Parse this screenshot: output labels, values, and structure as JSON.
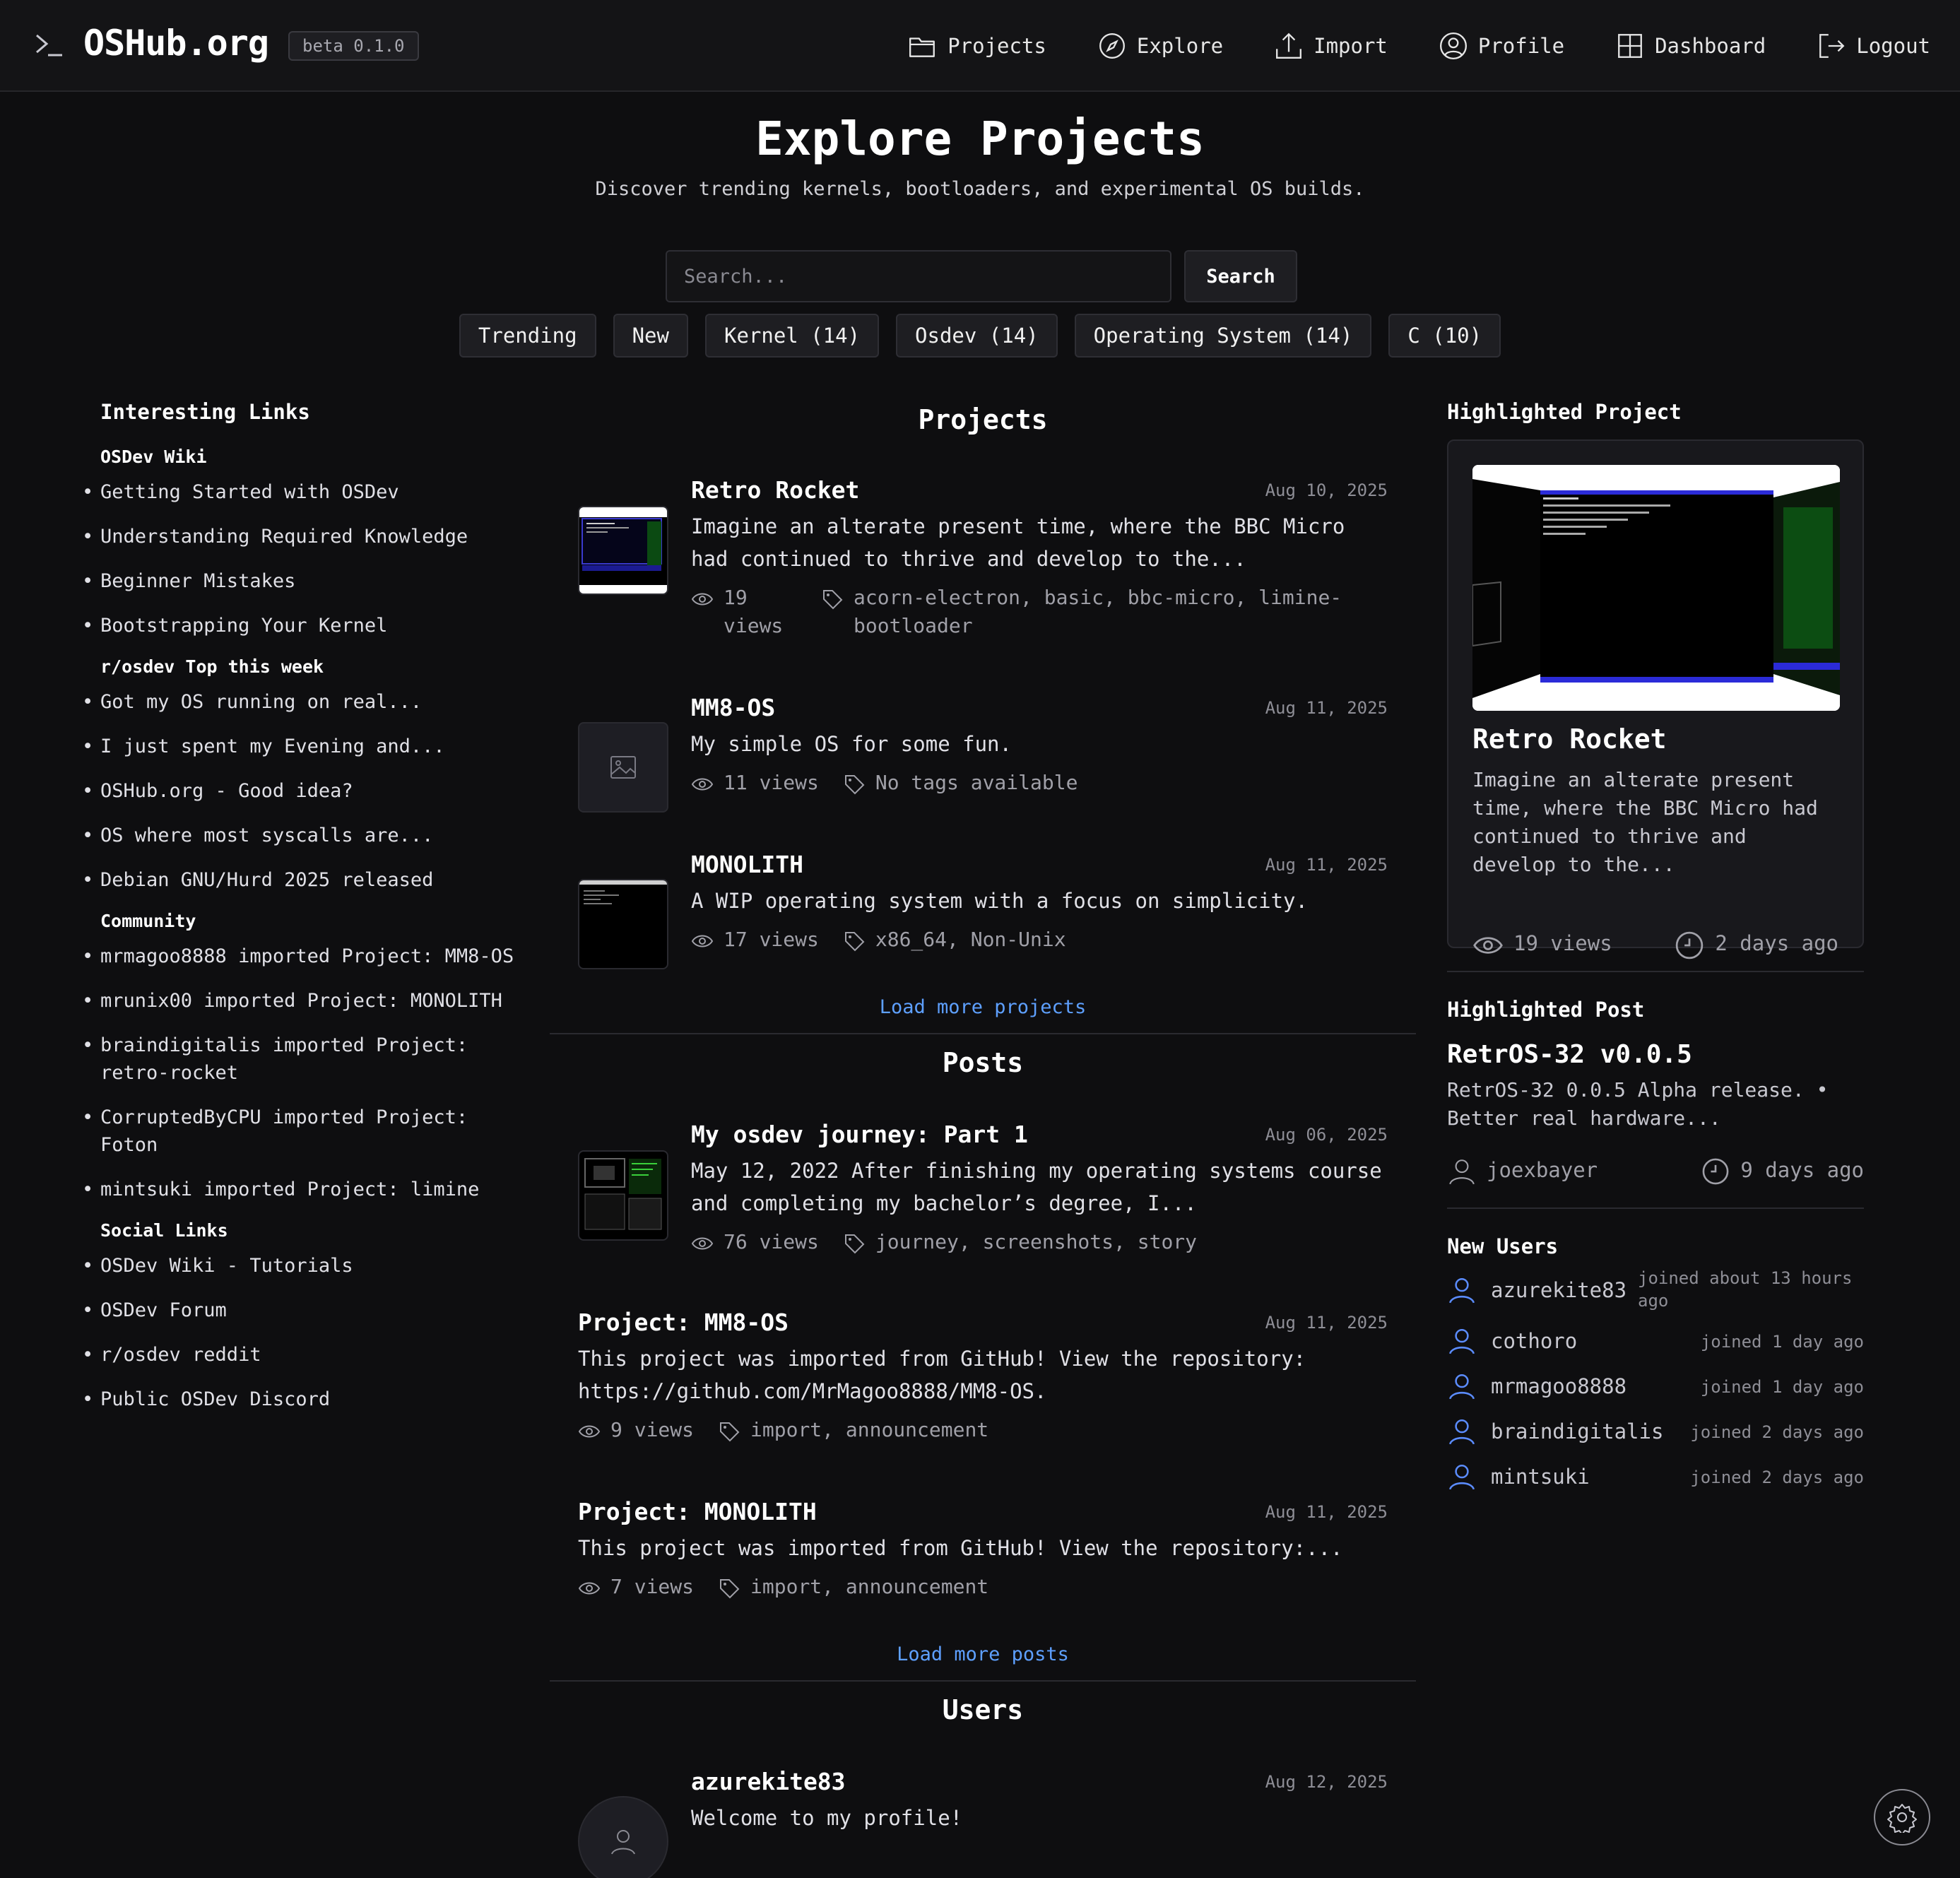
{
  "header": {
    "brand": "OSHub.org",
    "version": "beta 0.1.0",
    "nav": [
      {
        "label": "Projects",
        "icon": "folder-icon"
      },
      {
        "label": "Explore",
        "icon": "compass-icon"
      },
      {
        "label": "Import",
        "icon": "upload-icon"
      },
      {
        "label": "Profile",
        "icon": "user-circle-icon"
      },
      {
        "label": "Dashboard",
        "icon": "grid-icon"
      },
      {
        "label": "Logout",
        "icon": "logout-icon"
      }
    ]
  },
  "hero": {
    "title": "Explore Projects",
    "subtitle": "Discover trending kernels, bootloaders, and experimental OS builds.",
    "search_placeholder": "Search...",
    "search_label": "Search",
    "filters": [
      "Trending",
      "New",
      "Kernel (14)",
      "Osdev (14)",
      "Operating System (14)",
      "C (10)"
    ]
  },
  "left": {
    "title": "Interesting Links",
    "sections": [
      {
        "heading": "OSDev Wiki",
        "items": [
          "Getting Started with OSDev",
          "Understanding Required Knowledge",
          "Beginner Mistakes",
          "Bootstrapping Your Kernel"
        ]
      },
      {
        "heading": "r/osdev Top this week",
        "items": [
          "Got my OS running on real...",
          "I just spent my Evening and...",
          "OSHub.org - Good idea?",
          "OS where most syscalls are...",
          "Debian GNU/Hurd 2025 released"
        ]
      },
      {
        "heading": "Community",
        "items": [
          "mrmagoo8888 imported Project: MM8-OS",
          "mrunix00 imported Project: MONOLITH",
          "braindigitalis imported Project: retro-rocket",
          "CorruptedByCPU imported Project: Foton",
          "mintsuki imported Project: limine"
        ]
      },
      {
        "heading": "Social Links",
        "items": [
          "OSDev Wiki - Tutorials",
          "OSDev Forum",
          "r/osdev reddit",
          "Public OSDev Discord"
        ]
      }
    ]
  },
  "projects": {
    "title": "Projects",
    "items": [
      {
        "title": "Retro Rocket",
        "date": "Aug 10, 2025",
        "desc": "Imagine an alterate present time, where the BBC Micro had continued to thrive and develop to the...",
        "views": "19 views",
        "tags": "acorn-electron, basic, bbc-micro, limine-bootloader"
      },
      {
        "title": "MM8-OS",
        "date": "Aug 11, 2025",
        "desc": "My simple OS for some fun.",
        "views": "11 views",
        "tags": "No tags available"
      },
      {
        "title": "MONOLITH",
        "date": "Aug 11, 2025",
        "desc": "A WIP operating system with a focus on simplicity.",
        "views": "17 views",
        "tags": "x86_64, Non-Unix"
      }
    ],
    "load_more": "Load more projects"
  },
  "posts": {
    "title": "Posts",
    "items": [
      {
        "title": "My osdev journey: Part 1",
        "date": "Aug 06, 2025",
        "desc": "May 12, 2022 After finishing my operating systems course and completing my bachelor’s degree, I...",
        "views": "76 views",
        "tags": "journey, screenshots, story"
      },
      {
        "title": "Project: MM8-OS",
        "date": "Aug 11, 2025",
        "desc": "This project was imported from GitHub! View the repository: https://github.com/MrMagoo8888/MM8-OS.",
        "views": "9 views",
        "tags": "import, announcement"
      },
      {
        "title": "Project: MONOLITH",
        "date": "Aug 11, 2025",
        "desc": "This project was imported from GitHub! View the repository:...",
        "views": "7 views",
        "tags": "import, announcement"
      }
    ],
    "load_more": "Load more posts"
  },
  "users": {
    "title": "Users",
    "items": [
      {
        "name": "azurekite83",
        "date": "Aug 12, 2025",
        "bio": "Welcome to my profile!"
      }
    ]
  },
  "highlighted_project": {
    "title": "Highlighted Project",
    "name": "Retro Rocket",
    "desc": "Imagine an alterate present time, where the BBC Micro had continued to thrive and develop to the...",
    "views": "19 views",
    "age": "2 days ago"
  },
  "highlighted_post": {
    "title": "Highlighted Post",
    "name": "RetrOS-32 v0.0.5",
    "desc": "RetrOS-32 0.0.5 Alpha release. • Better real hardware...",
    "author": "joexbayer",
    "age": "9 days ago"
  },
  "new_users": {
    "title": "New Users",
    "items": [
      {
        "name": "azurekite83",
        "joined": "joined about 13 hours ago"
      },
      {
        "name": "cothoro",
        "joined": "joined 1 day ago"
      },
      {
        "name": "mrmagoo8888",
        "joined": "joined 1 day ago"
      },
      {
        "name": "braindigitalis",
        "joined": "joined 2 days ago"
      },
      {
        "name": "mintsuki",
        "joined": "joined 2 days ago"
      }
    ]
  },
  "colors": {
    "background": "#0e0e10",
    "link": "#5ea0ff",
    "user_icon": "#5b8cff"
  }
}
